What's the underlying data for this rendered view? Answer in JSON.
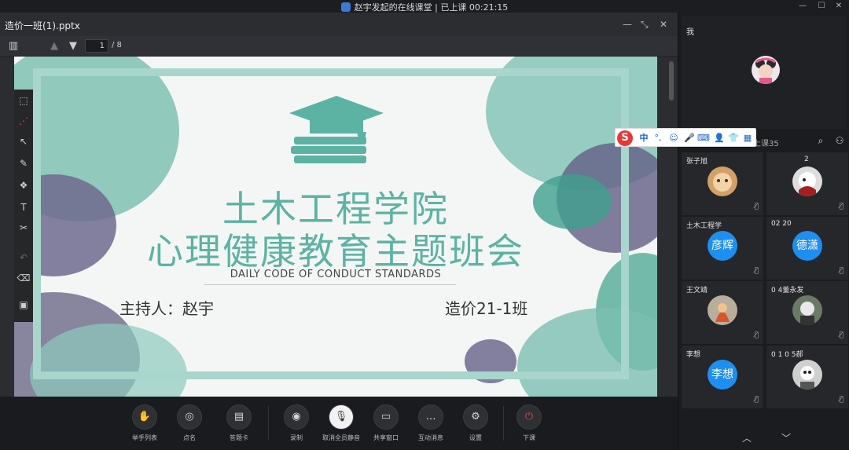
{
  "window": {
    "title": "赵宇发起的在线课堂 | 已上课 00:21:15",
    "controls": [
      "—",
      "☐",
      "✕"
    ]
  },
  "document": {
    "title": "造价一班(1).pptx",
    "page_current": "1",
    "page_total": "/ 8"
  },
  "slide": {
    "title_line1": "土木工程学院",
    "title_line2": "心理健康教育主题班会",
    "subtitle": "DAILY CODE OF CONDUCT STANDARDS",
    "host": "主持人：赵宇",
    "class": "造价21-1班"
  },
  "tools": [
    "select-add-icon",
    "laser-icon",
    "pointer-icon",
    "pen-icon",
    "shapes-icon",
    "text-icon",
    "scissors-icon",
    "undo-icon",
    "eraser-icon",
    "toolbox-icon"
  ],
  "bottom_controls": [
    {
      "label": "举手列表",
      "icon": "hand-icon"
    },
    {
      "label": "点名",
      "icon": "rollcall-icon"
    },
    {
      "label": "答题卡",
      "icon": "answer-card-icon"
    },
    {
      "label": "录制",
      "icon": "record-icon"
    },
    {
      "label": "取消全员静音",
      "icon": "unmute-all-icon"
    },
    {
      "label": "共享窗口",
      "icon": "share-window-icon"
    },
    {
      "label": "互动消息",
      "icon": "chat-icon"
    },
    {
      "label": "设置",
      "icon": "settings-icon"
    },
    {
      "label": "下课",
      "icon": "power-icon"
    }
  ],
  "right_panel": {
    "me_label": "我",
    "online_count": "上课35",
    "participants": [
      {
        "name": "张子旭",
        "avatar_text": ""
      },
      {
        "name": "2",
        "avatar_text": ""
      },
      {
        "name": "土木工程学",
        "avatar_text": "彦辉"
      },
      {
        "name": "02 20",
        "avatar_text": "德潇"
      },
      {
        "name": "王文靖",
        "avatar_text": ""
      },
      {
        "name": "0 4董永发",
        "avatar_text": ""
      },
      {
        "name": "李想",
        "avatar_text": "李想"
      },
      {
        "name": "0 1 0 5郝",
        "avatar_text": ""
      }
    ]
  },
  "ime": {
    "lang": "中",
    "punct": "°,"
  },
  "colors": {
    "accent_teal": "#5cb3a3",
    "avatar_blue": "#1f8ef1",
    "end_class_red": "#e0483a"
  }
}
